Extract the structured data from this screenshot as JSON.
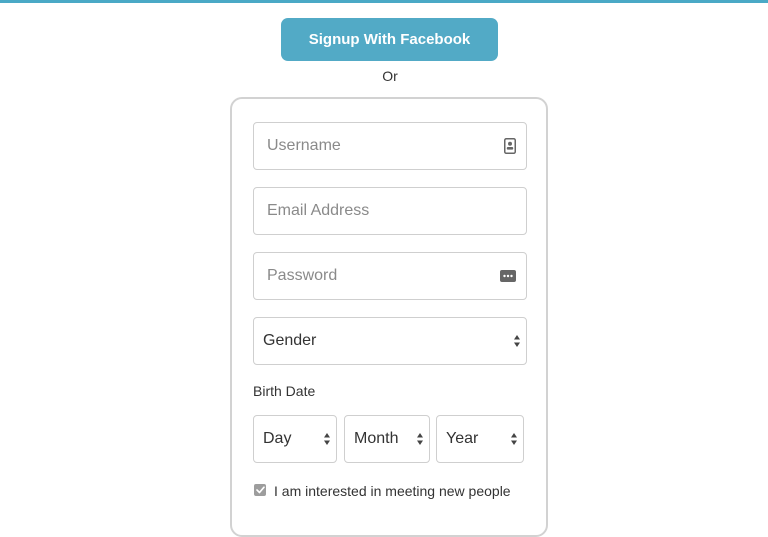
{
  "facebook_button": {
    "label": "Signup With Facebook"
  },
  "separator": {
    "label": "Or"
  },
  "form": {
    "username": {
      "placeholder": "Username",
      "icon": "contact-card-icon"
    },
    "email": {
      "placeholder": "Email Address"
    },
    "password": {
      "placeholder": "Password",
      "icon": "password-dots-icon"
    },
    "gender": {
      "selected": "Gender"
    },
    "birth_date": {
      "label": "Birth Date",
      "day": "Day",
      "month": "Month",
      "year": "Year"
    },
    "interest_checkbox": {
      "checked": true,
      "label": "I am interested in meeting new people"
    }
  },
  "colors": {
    "accent": "#52aac6",
    "top_bar": "#4aa9c6",
    "border": "#cfcfcf",
    "checkbox": "#9d9d9d"
  }
}
